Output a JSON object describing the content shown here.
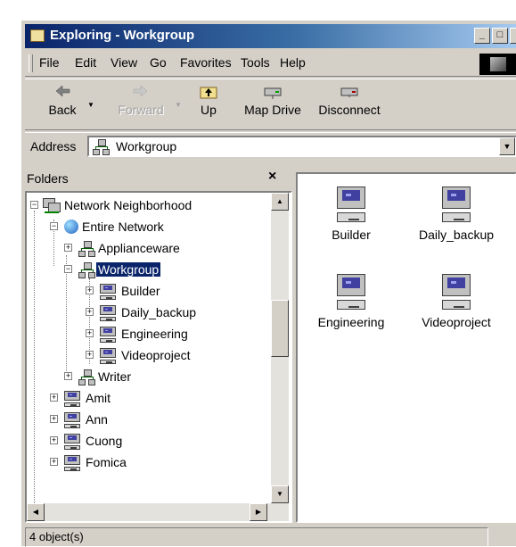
{
  "window": {
    "title": "Exploring - Workgroup",
    "controls": {
      "minimize": "_",
      "maximize": "□",
      "close": "×"
    }
  },
  "menu": {
    "items": [
      "File",
      "Edit",
      "View",
      "Go",
      "Favorites",
      "Tools",
      "Help"
    ]
  },
  "toolbar": {
    "back": "Back",
    "forward": "Forward",
    "up": "Up",
    "map_drive": "Map Drive",
    "disconnect": "Disconnect"
  },
  "address": {
    "label": "Address",
    "value": "Workgroup"
  },
  "folders": {
    "title": "Folders",
    "close": "×",
    "tree": [
      {
        "label": "Network Neighborhood",
        "expander": "−",
        "icon": "network-neighborhood-icon"
      },
      {
        "label": "Entire Network",
        "expander": "−",
        "icon": "globe-icon"
      },
      {
        "label": "Applianceware",
        "expander": "+",
        "icon": "workgroup-icon"
      },
      {
        "label": "Workgroup",
        "expander": "−",
        "icon": "workgroup-icon",
        "selected": true
      },
      {
        "label": "Builder",
        "expander": "+",
        "icon": "computer-icon"
      },
      {
        "label": "Daily_backup",
        "expander": "+",
        "icon": "computer-icon"
      },
      {
        "label": "Engineering",
        "expander": "+",
        "icon": "computer-icon"
      },
      {
        "label": "Videoproject",
        "expander": "+",
        "icon": "computer-icon"
      },
      {
        "label": "Writer",
        "expander": "+",
        "icon": "workgroup-icon"
      },
      {
        "label": "Amit",
        "expander": "+",
        "icon": "computer-icon"
      },
      {
        "label": "Ann",
        "expander": "+",
        "icon": "computer-icon"
      },
      {
        "label": "Cuong",
        "expander": "+",
        "icon": "computer-icon"
      },
      {
        "label": "Fomica",
        "expander": "+",
        "icon": "computer-icon"
      }
    ]
  },
  "content": {
    "items": [
      {
        "label": "Builder",
        "icon": "computer-icon"
      },
      {
        "label": "Daily_backup",
        "icon": "computer-icon"
      },
      {
        "label": "Engineering",
        "icon": "computer-icon"
      },
      {
        "label": "Videoproject",
        "icon": "computer-icon"
      }
    ]
  },
  "status": {
    "text": "4 object(s)"
  },
  "colors": {
    "titlebar_start": "#0a246a",
    "titlebar_end": "#a6caf0",
    "selection": "#0a246a",
    "face": "#d4d0c8"
  }
}
